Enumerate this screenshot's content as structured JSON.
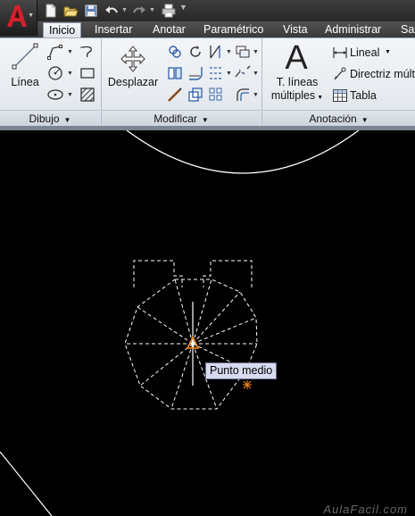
{
  "quick_access": {
    "icons": [
      "new-file-icon",
      "open-folder-icon",
      "save-icon",
      "undo-icon",
      "redo-icon",
      "print-icon"
    ]
  },
  "tabs": [
    {
      "label": "Inicio",
      "active": true
    },
    {
      "label": "Insertar",
      "active": false
    },
    {
      "label": "Anotar",
      "active": false
    },
    {
      "label": "Paramétrico",
      "active": false
    },
    {
      "label": "Vista",
      "active": false
    },
    {
      "label": "Administrar",
      "active": false
    },
    {
      "label": "Sa",
      "active": false
    }
  ],
  "panels": {
    "dibujo": {
      "title": "Dibujo",
      "line_label": "Línea"
    },
    "modificar": {
      "title": "Modificar",
      "move_label": "Desplazar"
    },
    "anotacion": {
      "title": "Anotación",
      "mtext_label_1": "T. líneas",
      "mtext_label_2": "múltiples",
      "mtext_icon_glyph": "A",
      "lineal_label": "Lineal",
      "directriz_label": "Directriz múlt",
      "tabla_label": "Tabla"
    }
  },
  "drawing": {
    "snap_tooltip": "Punto medio",
    "background_color": "#000000",
    "line_color": "#ffffff",
    "snap_marker_color": "#ff8c1a"
  },
  "watermark": "AulaFacil.com"
}
